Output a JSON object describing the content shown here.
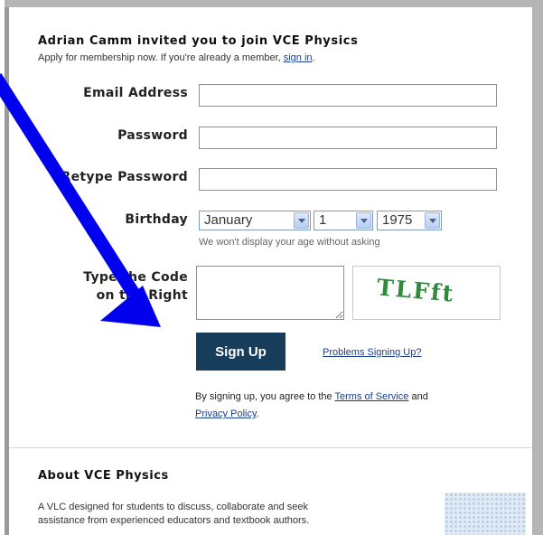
{
  "invite": {
    "heading": "Adrian Camm invited you to join VCE Physics",
    "subheading_text": "Apply for membership now. If you're already a member, ",
    "sign_in_link": "sign in",
    "subheading_end": "."
  },
  "form": {
    "email_label": "Email Address",
    "email_value": "",
    "password_label": "Password",
    "password_value": "",
    "retype_label": "Retype Password",
    "retype_value": "",
    "birthday_label": "Birthday",
    "birthday_month": "January",
    "birthday_day": "1",
    "birthday_year": "1975",
    "birthday_helper": "We won't display your age without asking",
    "code_label_line1": "Type the Code",
    "code_label_line2": "on the Right",
    "code_value": "",
    "captcha_text": "TLFft"
  },
  "actions": {
    "signup_label": "Sign Up",
    "problems_link": "Problems Signing Up?"
  },
  "terms": {
    "prefix": "By signing up, you agree to the ",
    "tos_link": "Terms of Service",
    "middle": " and",
    "privacy_link": "Privacy Policy",
    "suffix": "."
  },
  "about": {
    "title": "About VCE Physics",
    "line1": "A VLC designed for students to discuss, collaborate and seek",
    "line2": "assistance from experienced educators and textbook authors."
  },
  "colors": {
    "arrow": "#0000ee",
    "button": "#173d5b",
    "link": "#1a3d8f",
    "captcha": "#2f8a3a"
  },
  "icons": {
    "select_arrow": "chevron-down-icon",
    "annotation": "arrow-annotation"
  }
}
